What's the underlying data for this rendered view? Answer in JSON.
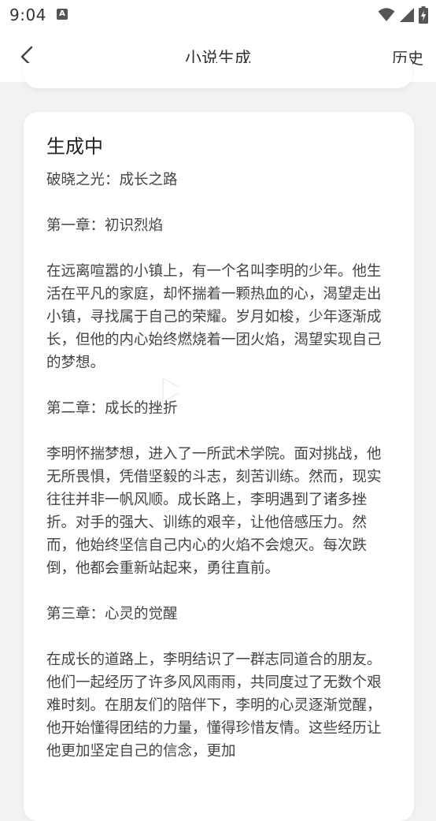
{
  "status_bar": {
    "time": "9:04",
    "notification_icon": "a-icon",
    "icons": [
      "wifi-icon",
      "signal-icon",
      "battery-charging-icon"
    ]
  },
  "header": {
    "title": "小说生成",
    "history_label": "历史",
    "back_icon": "chevron-left-icon"
  },
  "card": {
    "status_title": "生成中",
    "content": "破晓之光：成长之路\n\n第一章：初识烈焰\n\n在远离喧嚣的小镇上，有一个名叫李明的少年。他生活在平凡的家庭，却怀揣着一颗热血的心，渴望走出小镇，寻找属于自己的荣耀。岁月如梭，少年逐渐成长，但他的内心始终燃烧着一团火焰，渴望实现自己的梦想。\n\n第二章：成长的挫折\n\n李明怀揣梦想，进入了一所武术学院。面对挑战，他无所畏惧，凭借坚毅的斗志，刻苦训练。然而，现实往往并非一帆风顺。成长路上，李明遇到了诸多挫折。对手的强大、训练的艰辛，让他倍感压力。然而，他始终坚信自己内心的火焰不会熄灭。每次跌倒，他都会重新站起来，勇往直前。\n\n第三章：心灵的觉醒\n\n在成长的道路上，李明结识了一群志同道合的朋友。他们一起经历了许多风风雨雨，共同度过了无数个艰难时刻。在朋友们的陪伴下，李明的心灵逐渐觉醒，他开始懂得团结的力量，懂得珍惜友情。这些经历让他更加坚定自己的信念，更加"
  },
  "colors": {
    "background": "#f2f2f2",
    "card": "#ffffff",
    "text": "#444444"
  }
}
